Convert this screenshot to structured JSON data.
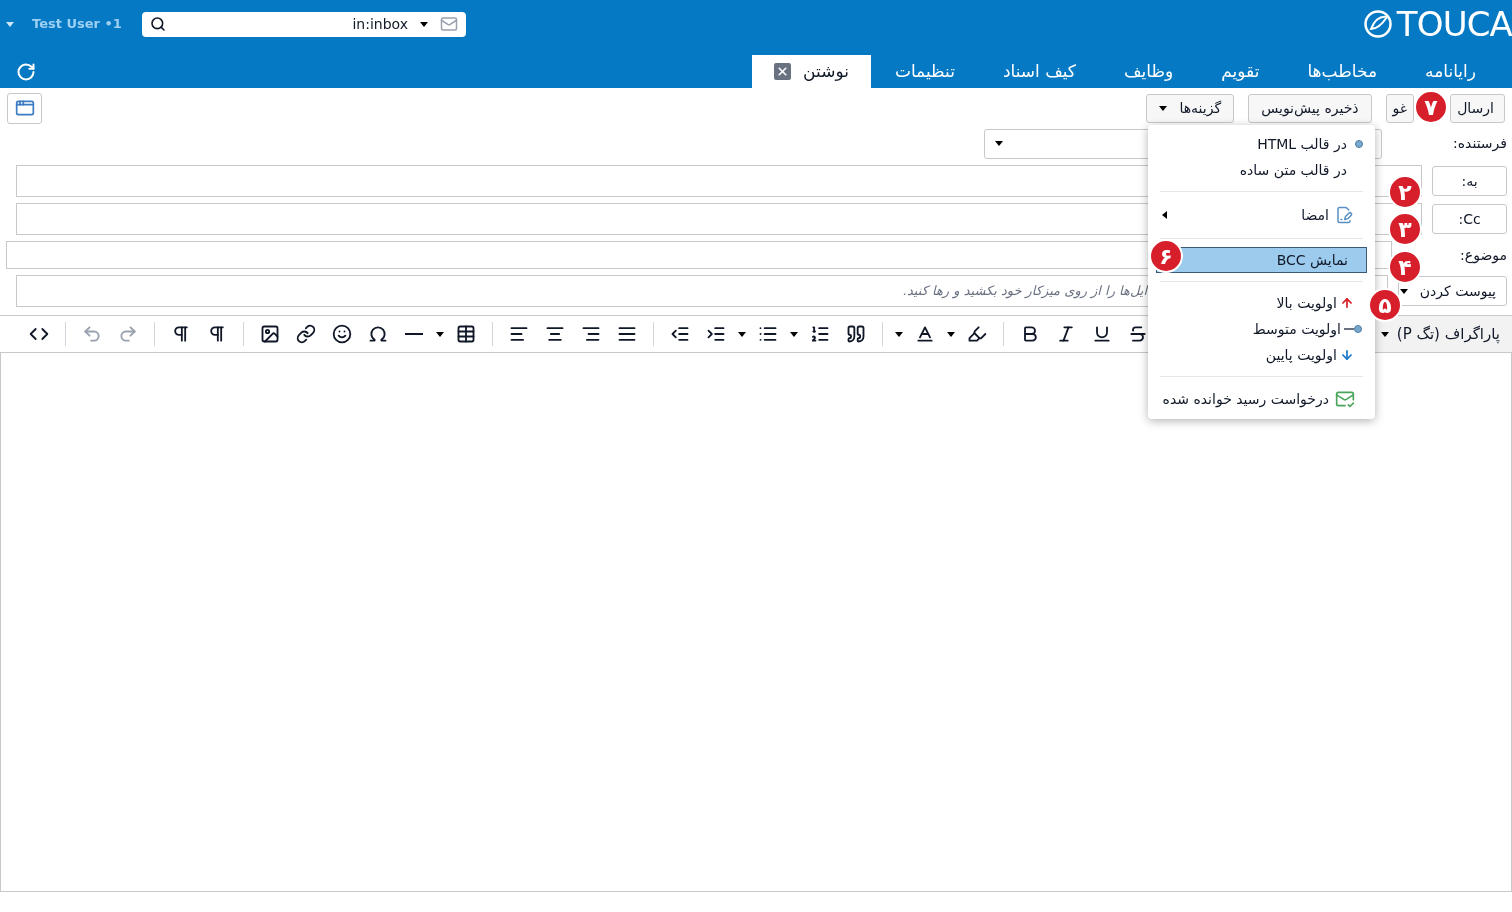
{
  "header": {
    "user": "Test User •1",
    "search": {
      "value": "in:inbox"
    },
    "logo": "TOUCA"
  },
  "tabs": [
    {
      "label": "رایانامه",
      "selected": false,
      "closable": false
    },
    {
      "label": "مخاطب‌ها",
      "selected": false,
      "closable": false
    },
    {
      "label": "تقویم",
      "selected": false,
      "closable": false
    },
    {
      "label": "وظایف",
      "selected": false,
      "closable": false
    },
    {
      "label": "کیف اسناد",
      "selected": false,
      "closable": false
    },
    {
      "label": "تنظیمات",
      "selected": false,
      "closable": false
    },
    {
      "label": "نوشتن",
      "selected": true,
      "closable": true
    }
  ],
  "toolbar": {
    "send": "ارسال",
    "cancel": "غو",
    "save_draft": "ذخیره پیش‌نویس",
    "options": "گزینه‌ها"
  },
  "form": {
    "sender_label": "فرستنده:",
    "to": "به:",
    "cc": "Cc:",
    "subject_label": "موضوع:",
    "attach": "پیوست کردن",
    "drop_hint": "ایل‌ها را از روی میزکار خود بکشید و رها کنید."
  },
  "editor_toolbar": {
    "format": "پاراگراف (تگ P)",
    "tools": [
      {
        "kind": "strike",
        "disabled": false
      },
      {
        "kind": "underline",
        "disabled": false
      },
      {
        "kind": "italic",
        "disabled": false
      },
      {
        "kind": "bold",
        "disabled": false
      },
      {
        "kind": "sep"
      },
      {
        "kind": "highlight",
        "disabled": false
      },
      {
        "kind": "caret",
        "disabled": false
      },
      {
        "kind": "color",
        "disabled": false
      },
      {
        "kind": "caret",
        "disabled": false
      },
      {
        "kind": "sep"
      },
      {
        "kind": "quote",
        "disabled": false
      },
      {
        "kind": "numbered",
        "disabled": false
      },
      {
        "kind": "caret",
        "disabled": false
      },
      {
        "kind": "bullets",
        "disabled": false
      },
      {
        "kind": "caret",
        "disabled": false
      },
      {
        "kind": "indent",
        "disabled": false
      },
      {
        "kind": "outdent",
        "disabled": false
      },
      {
        "kind": "sep"
      },
      {
        "kind": "justify",
        "disabled": false
      },
      {
        "kind": "right",
        "disabled": false
      },
      {
        "kind": "center",
        "disabled": false
      },
      {
        "kind": "left",
        "disabled": false
      },
      {
        "kind": "sep"
      },
      {
        "kind": "table",
        "disabled": false
      },
      {
        "kind": "caret",
        "disabled": false
      },
      {
        "kind": "rule",
        "disabled": false
      },
      {
        "kind": "omega",
        "disabled": false
      },
      {
        "kind": "emoji",
        "disabled": false
      },
      {
        "kind": "link",
        "disabled": false
      },
      {
        "kind": "image",
        "disabled": false
      },
      {
        "kind": "sep"
      },
      {
        "kind": "rtl",
        "disabled": false
      },
      {
        "kind": "ltr",
        "disabled": false
      },
      {
        "kind": "sep"
      },
      {
        "kind": "redo",
        "disabled": true
      },
      {
        "kind": "undo",
        "disabled": true
      },
      {
        "kind": "sep"
      },
      {
        "kind": "code",
        "disabled": false
      }
    ]
  },
  "menu": {
    "items": [
      {
        "kind": "radio",
        "label": "در قالب HTML",
        "selected": true
      },
      {
        "kind": "radio",
        "label": "در قالب متن ساده",
        "selected": false
      },
      {
        "kind": "separator"
      },
      {
        "kind": "submenu",
        "label": "امضا"
      },
      {
        "kind": "separator"
      },
      {
        "kind": "toggle",
        "label": "نمایش BCC",
        "highlighted": true
      },
      {
        "kind": "separator"
      },
      {
        "kind": "high_priority",
        "label": "اولویت بالا",
        "selected": false
      },
      {
        "kind": "normal_priority",
        "label": "اولویت متوسط",
        "selected": true
      },
      {
        "kind": "low_priority",
        "label": "اولویت پایین",
        "selected": false
      },
      {
        "kind": "separator"
      },
      {
        "kind": "receipt",
        "label": "درخواست رسید خوانده شده"
      }
    ]
  },
  "callouts": [
    {
      "label": "۷"
    },
    {
      "label": "۲"
    },
    {
      "label": "۳"
    },
    {
      "label": "۴"
    },
    {
      "label": "۵"
    },
    {
      "label": "۶"
    }
  ]
}
